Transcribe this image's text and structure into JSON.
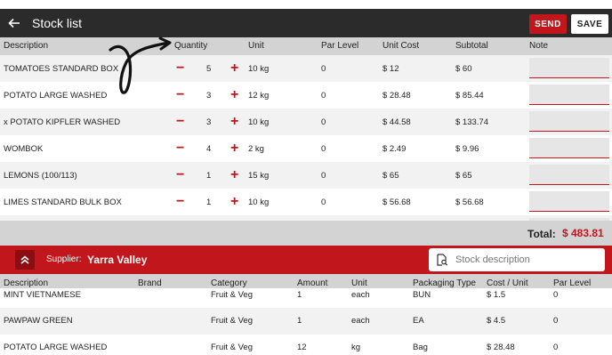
{
  "header": {
    "title": "Stock list",
    "send_label": "SEND",
    "save_label": "SAVE"
  },
  "stock_table": {
    "columns": [
      "Description",
      "Quantity",
      "Unit",
      "Par Level",
      "Unit Cost",
      "Subtotal",
      "Note"
    ],
    "rows": [
      {
        "description": "TOMATOES STANDARD BOX",
        "qty": "5",
        "unit": "10 kg",
        "par": "0",
        "unit_cost": "$ 12",
        "subtotal": "$ 60"
      },
      {
        "description": "POTATO LARGE WASHED",
        "qty": "3",
        "unit": "12 kg",
        "par": "0",
        "unit_cost": "$ 28.48",
        "subtotal": "$ 85.44"
      },
      {
        "description": "x POTATO KIPFLER WASHED",
        "qty": "3",
        "unit": "10 kg",
        "par": "0",
        "unit_cost": "$ 44.58",
        "subtotal": "$ 133.74"
      },
      {
        "description": "WOMBOK",
        "qty": "4",
        "unit": "2 kg",
        "par": "0",
        "unit_cost": "$ 2.49",
        "subtotal": "$ 9.96"
      },
      {
        "description": "LEMONS (100/113)",
        "qty": "1",
        "unit": "15 kg",
        "par": "0",
        "unit_cost": "$ 65",
        "subtotal": "$ 65"
      },
      {
        "description": "LIMES STANDARD BULK BOX",
        "qty": "1",
        "unit": "10 kg",
        "par": "0",
        "unit_cost": "$ 56.68",
        "subtotal": "$ 56.68"
      }
    ],
    "minus_symbol": "−",
    "plus_symbol": "+"
  },
  "total": {
    "label": "Total:",
    "value": "$ 483.81"
  },
  "supplier": {
    "label": "Supplier:",
    "name": "Yarra Valley",
    "search_placeholder": "Stock description"
  },
  "catalog_table": {
    "columns": [
      "Description",
      "Brand",
      "Category",
      "Amount",
      "Unit",
      "Packaging Type",
      "Cost / Unit",
      "Par Level"
    ],
    "rows": [
      {
        "description": "MINT VIETNAMESE",
        "brand": "",
        "category": "Fruit & Veg",
        "amount": "1",
        "unit": "each",
        "packaging": "BUN",
        "cost": "$ 1.5",
        "par": "0"
      },
      {
        "description": "PAWPAW GREEN",
        "brand": "",
        "category": "Fruit & Veg",
        "amount": "1",
        "unit": "each",
        "packaging": "EA",
        "cost": "$ 4.5",
        "par": "0"
      },
      {
        "description": "POTATO LARGE WASHED",
        "brand": "",
        "category": "Fruit & Veg",
        "amount": "12",
        "unit": "kg",
        "packaging": "Bag",
        "cost": "$ 28.48",
        "par": "0"
      }
    ]
  },
  "colors": {
    "accent": "#c0161c",
    "appbar": "#2b2b2b",
    "header_bg": "#d3d3d3"
  },
  "icons": {
    "back": "arrow-left-icon",
    "collapse": "chevrons-up-icon",
    "search": "document-search-icon"
  }
}
